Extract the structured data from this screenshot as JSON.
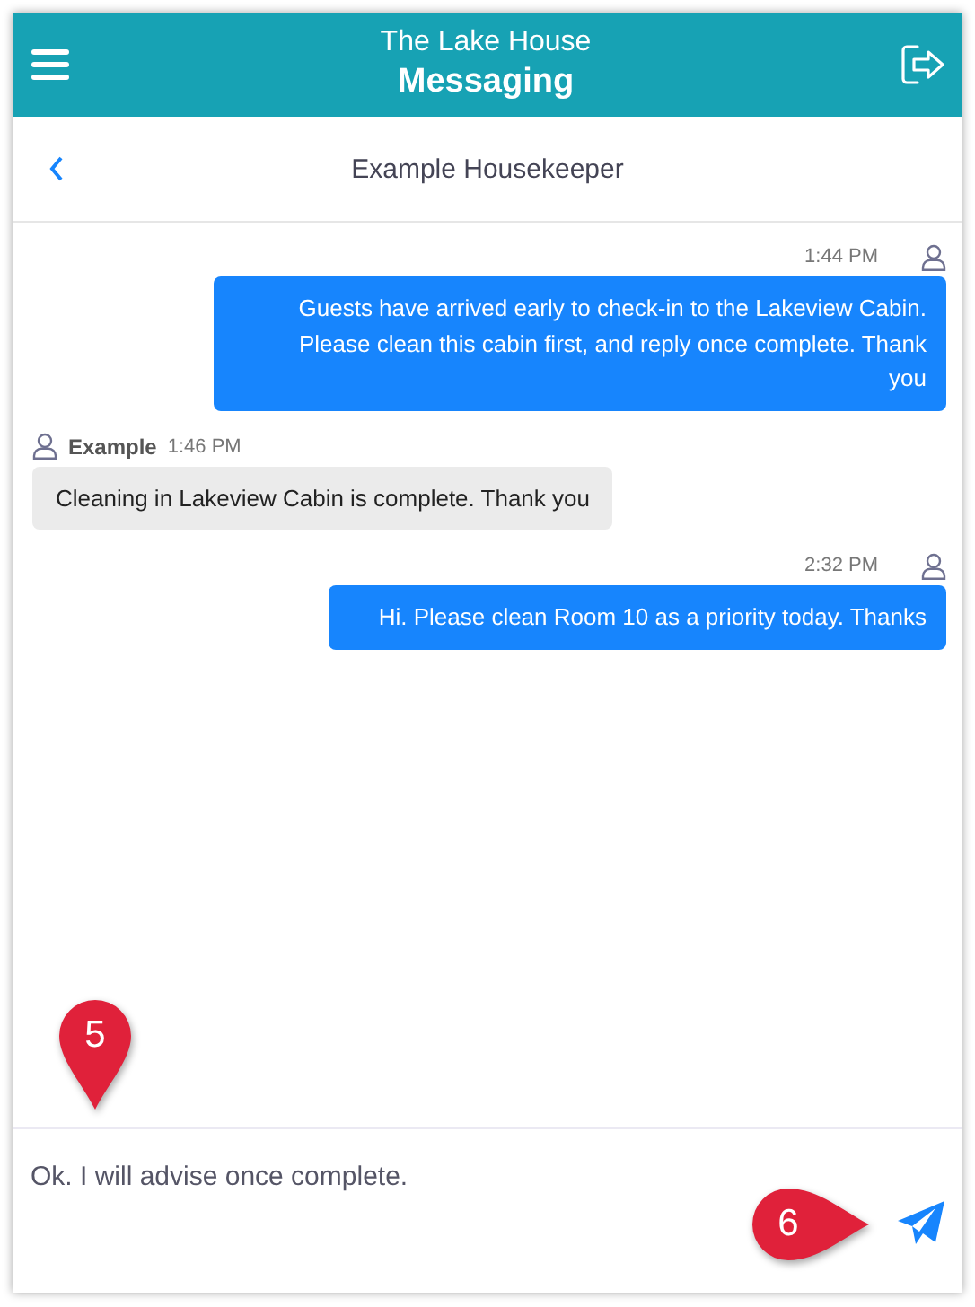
{
  "header": {
    "subtitle": "The Lake House",
    "title": "Messaging"
  },
  "conversation": {
    "title": "Example Housekeeper"
  },
  "messages": [
    {
      "kind": "sent",
      "time": "1:44 PM",
      "text": "Guests have arrived early to check-in to the Lakeview Cabin. Please clean this cabin first, and reply once complete. Thank you"
    },
    {
      "kind": "received",
      "sender": "Example",
      "time": "1:46 PM",
      "text": "Cleaning in Lakeview Cabin is complete. Thank you"
    },
    {
      "kind": "sent",
      "time": "2:32 PM",
      "text": "Hi. Please clean Room 10 as a priority today. Thanks"
    }
  ],
  "composer": {
    "value": "Ok. I will advise once complete."
  },
  "callouts": [
    {
      "number": "5",
      "kind": "down"
    },
    {
      "number": "6",
      "kind": "right"
    }
  ]
}
